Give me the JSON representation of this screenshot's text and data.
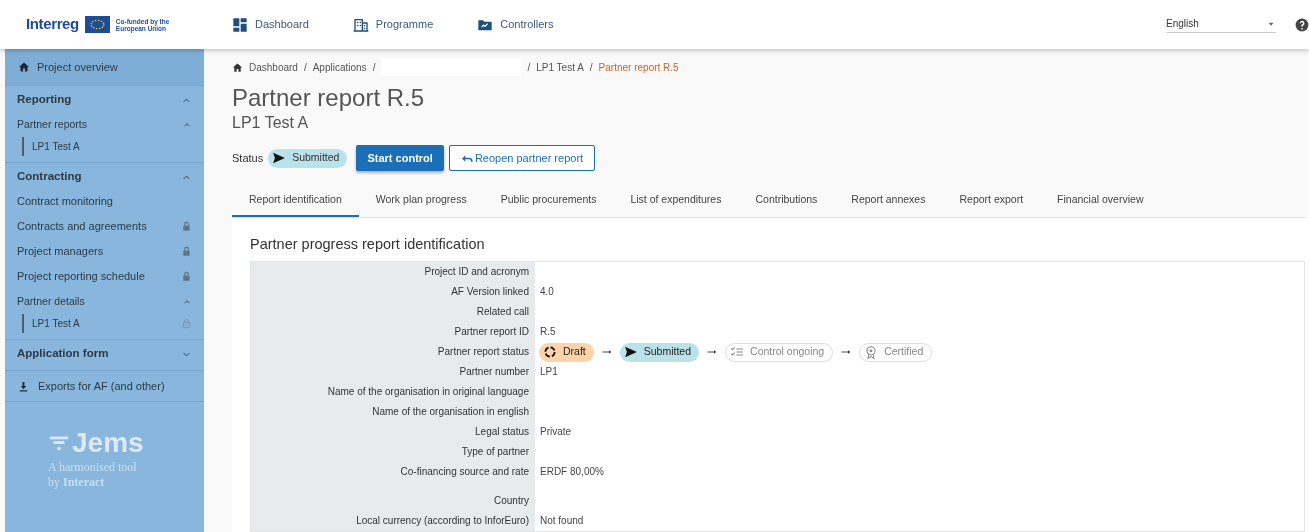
{
  "header": {
    "brand": "Interreg",
    "cofunded": "Co-funded by the European Union",
    "nav": [
      {
        "label": "Dashboard",
        "kind": "dashboard"
      },
      {
        "label": "Programme",
        "kind": "programme"
      },
      {
        "label": "Controllers",
        "kind": "controllers"
      }
    ],
    "language": "English"
  },
  "sidebar": {
    "overview": "Project overview",
    "sections": [
      {
        "label": "Reporting",
        "expanded": true,
        "items": [
          {
            "label": "Partner reports",
            "kind": "group",
            "expanded": true,
            "children": [
              {
                "label": "LP1 Test A",
                "locked": false
              }
            ]
          }
        ]
      },
      {
        "label": "Contracting",
        "expanded": true,
        "items": [
          {
            "label": "Contract monitoring",
            "kind": "link",
            "locked": false
          },
          {
            "label": "Contracts and agreements",
            "kind": "link",
            "locked": true
          },
          {
            "label": "Project managers",
            "kind": "link",
            "locked": true
          },
          {
            "label": "Project reporting schedule",
            "kind": "link",
            "locked": true
          },
          {
            "label": "Partner details",
            "kind": "group",
            "expanded": true,
            "children": [
              {
                "label": "LP1 Test A",
                "locked": true
              }
            ]
          }
        ]
      },
      {
        "label": "Application form",
        "expanded": false
      }
    ],
    "exports": "Exports for AF (and other)",
    "logo": {
      "name": "Jems",
      "tagline": "A harmonised tool",
      "by": "by **Interact**"
    }
  },
  "breadcrumb": {
    "separator": "/",
    "items": [
      {
        "label": "Dashboard",
        "kind": "home",
        "current": false
      },
      {
        "label": "Applications",
        "kind": "link",
        "current": false
      },
      {
        "kind": "hidden"
      },
      {
        "label": "LP1 Test A",
        "kind": "link",
        "current": false
      },
      {
        "label": "Partner report R.5",
        "kind": "link",
        "current": true
      }
    ]
  },
  "title": "Partner report R.5",
  "subtitle": "LP1 Test A",
  "status": {
    "label": "Status",
    "value": "Submitted"
  },
  "buttons": [
    {
      "label": "Start control",
      "kind": "primary"
    },
    {
      "label": "Reopen partner report",
      "kind": "outline"
    }
  ],
  "tabs": [
    {
      "label": "Report identification",
      "selected": true
    },
    {
      "label": "Work plan progress",
      "selected": false
    },
    {
      "label": "Public procurements",
      "selected": false
    },
    {
      "label": "List of expenditures",
      "selected": false
    },
    {
      "label": "Contributions",
      "selected": false
    },
    {
      "label": "Report annexes",
      "selected": false
    },
    {
      "label": "Report export",
      "selected": false
    },
    {
      "label": "Financial overview",
      "selected": false
    }
  ],
  "section_title": "Partner progress report identification",
  "rows": [
    {
      "label": "Project ID and acronym",
      "kind": "text"
    },
    {
      "label": "AF Version linked",
      "kind": "text",
      "value": "4.0"
    },
    {
      "label": "Related call",
      "kind": "text"
    },
    {
      "label": "Partner report ID",
      "kind": "text",
      "value": "R.5"
    },
    {
      "label": "Partner report status",
      "kind": "flow",
      "steps": [
        {
          "label": "Draft",
          "kind": "draft",
          "active": true,
          "color": "#fdd3a8"
        },
        {
          "label": "Submitted",
          "kind": "submitted",
          "active": true,
          "color": "#b9e2ea"
        },
        {
          "label": "Control ongoing",
          "kind": "control",
          "active": false
        },
        {
          "label": "Certified",
          "kind": "certified",
          "active": false
        }
      ]
    },
    {
      "label": "Partner number",
      "kind": "text",
      "value": "LP1"
    },
    {
      "label": "Name of the organisation in original language",
      "kind": "text"
    },
    {
      "label": "Name of the organisation in english",
      "kind": "text"
    },
    {
      "label": "Legal status",
      "kind": "text",
      "value": "Private"
    },
    {
      "label": "Type of partner",
      "kind": "text"
    },
    {
      "label": "Co-financing source and rate",
      "kind": "tall",
      "value": "ERDF 80,00%"
    },
    {
      "label": "Country",
      "kind": "text"
    },
    {
      "label": "Local currency (according to InforEuro)",
      "kind": "text",
      "value": "Not found"
    }
  ]
}
